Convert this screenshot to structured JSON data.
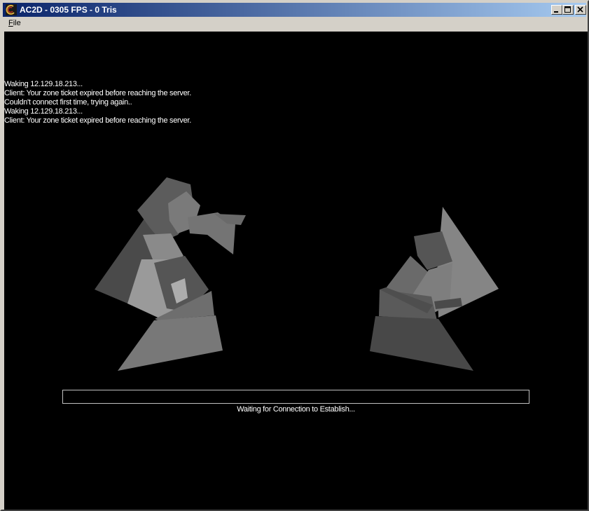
{
  "window": {
    "title": "AC2D - 0305 FPS - 0 Tris",
    "controls": {
      "minimize": "minimize-icon",
      "maximize": "maximize-icon",
      "close": "close-icon"
    }
  },
  "menu": {
    "file_accel": "F",
    "file_rest": "ile"
  },
  "log": {
    "lines": [
      "Waking 12.129.18.213...",
      "Client: Your zone ticket expired before reaching the server.",
      "Couldn't connect first time, trying again..",
      "Waking 12.129.18.213...",
      "Client: Your zone ticket expired before reaching the server."
    ]
  },
  "progress": {
    "fraction": 0
  },
  "status_text": "Waiting for Connection to Establish...",
  "colors": {
    "viewport_bg": "#000000",
    "title_start": "#0a246a",
    "title_end": "#a6caf0",
    "text": "#ffffff"
  }
}
